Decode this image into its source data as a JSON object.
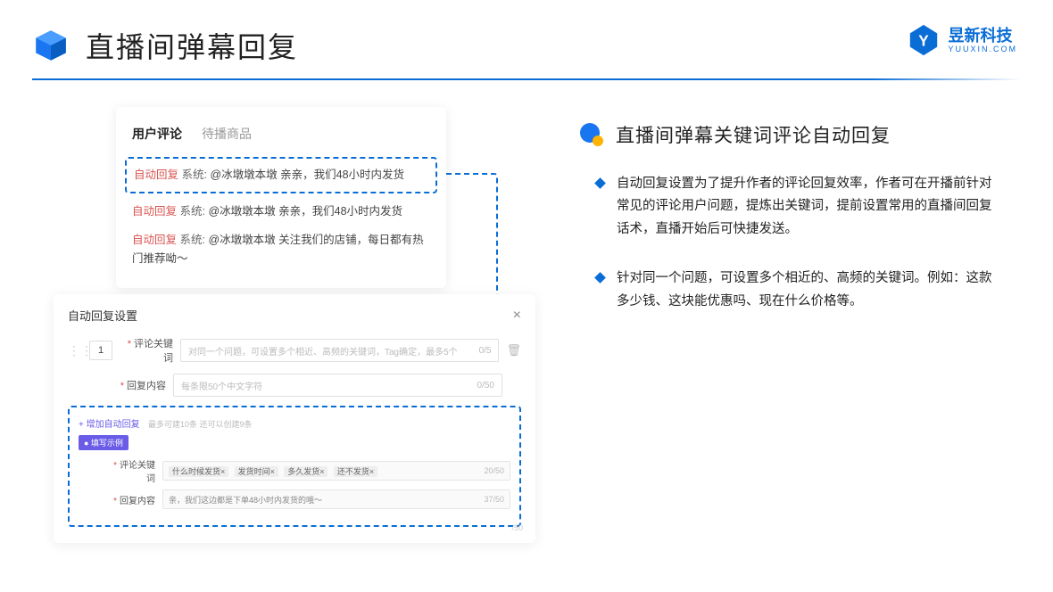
{
  "header": {
    "title": "直播间弹幕回复"
  },
  "brand": {
    "cn": "昱新科技",
    "en": "YUUXIN.COM"
  },
  "comments": {
    "tab_active": "用户评论",
    "tab_inactive": "待播商品",
    "highlighted": {
      "tag": "自动回复",
      "sys": "系统:",
      "text": "@冰墩墩本墩 亲亲，我们48小时内发货"
    },
    "line2": {
      "tag": "自动回复",
      "sys": "系统:",
      "text": "@冰墩墩本墩 亲亲，我们48小时内发货"
    },
    "line3": {
      "tag": "自动回复",
      "sys": "系统:",
      "text": "@冰墩墩本墩 关注我们的店铺，每日都有热门推荐呦～"
    }
  },
  "settings": {
    "title": "自动回复设置",
    "num": "1",
    "kw_label": "评论关键词",
    "kw_placeholder": "对同一个问题，可设置多个相近、高频的关键词，Tag确定，最多5个",
    "kw_count": "0/5",
    "content_label": "回复内容",
    "content_placeholder": "每条限50个中文字符",
    "content_count": "0/50",
    "add_label": "+ 增加自动回复",
    "add_hint": "最多可建10条 还可以创建9条",
    "example_tag": "● 填写示例",
    "ex_kw_label": "评论关键词",
    "ex_tags": [
      "什么时候发货×",
      "发货时间×",
      "多久发货×",
      "还不发货×"
    ],
    "ex_kw_count": "20/50",
    "ex_content_label": "回复内容",
    "ex_content_text": "亲，我们这边都是下单48小时内发货的哦～",
    "ex_content_count": "37/50",
    "stray_count": "/50"
  },
  "right": {
    "title": "直播间弹幕关键词评论自动回复",
    "bullets": [
      "自动回复设置为了提升作者的评论回复效率，作者可在开播前针对常见的评论用户问题，提炼出关键词，提前设置常用的直播间回复话术，直播开始后可快捷发送。",
      "针对同一个问题，可设置多个相近的、高频的关键词。例如：这款多少钱、这块能优惠吗、现在什么价格等。"
    ]
  }
}
